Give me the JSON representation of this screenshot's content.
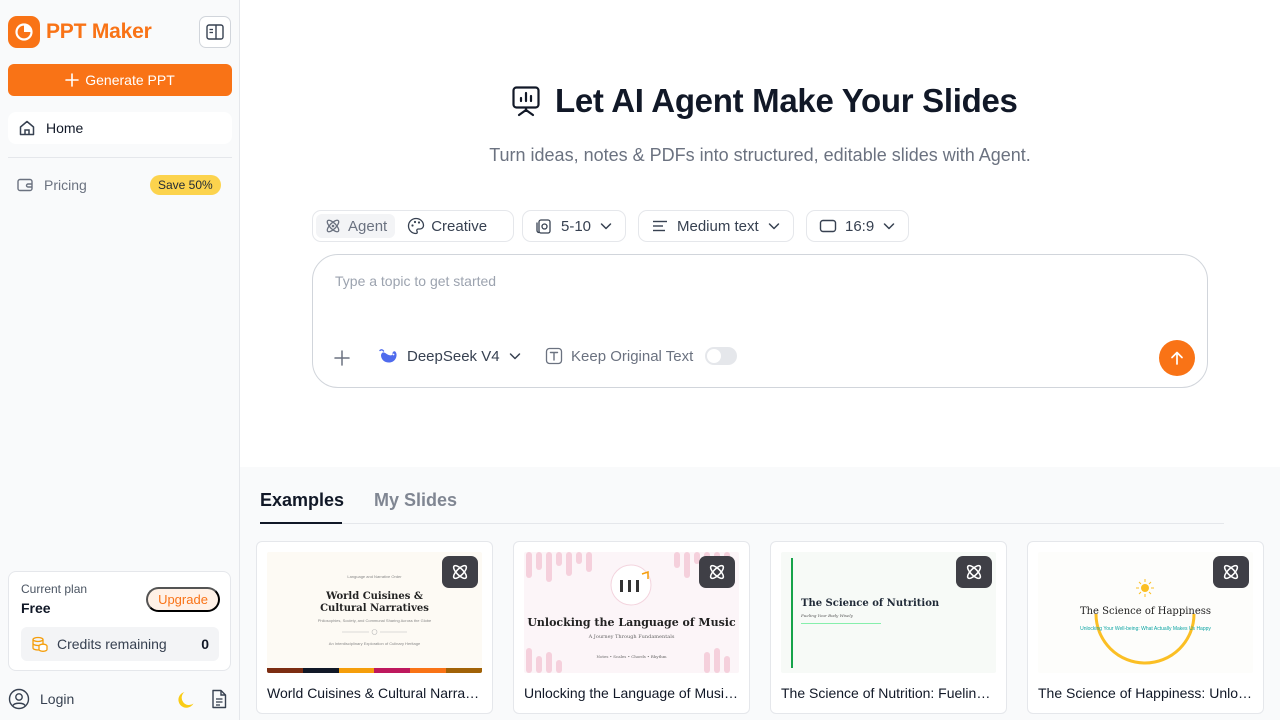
{
  "app": {
    "name": "PPT Maker",
    "accent": "#f97316"
  },
  "sidebar": {
    "generate_label": "Generate PPT",
    "nav": [
      {
        "label": "Home",
        "icon": "home-icon"
      },
      {
        "label": "Pricing",
        "icon": "wallet-icon",
        "badge": "Save 50%"
      }
    ],
    "plan": {
      "label": "Current plan",
      "value": "Free",
      "upgrade_label": "Upgrade"
    },
    "credits": {
      "label": "Credits remaining",
      "count": "0"
    },
    "login_label": "Login"
  },
  "hero": {
    "title": "Let AI Agent Make Your Slides",
    "subtitle": "Turn ideas, notes & PDFs into structured, editable slides with Agent."
  },
  "options": {
    "modes": [
      {
        "label": "Agent",
        "active": true
      },
      {
        "label": "Creative",
        "active": false
      }
    ],
    "slide_count": "5-10",
    "text_amount": "Medium text",
    "aspect_ratio": "16:9"
  },
  "prompt": {
    "placeholder": "Type a topic to get started",
    "model": "DeepSeek V4",
    "keep_original_label": "Keep Original Text",
    "keep_original_on": false
  },
  "tabs": [
    {
      "label": "Examples",
      "active": true
    },
    {
      "label": "My Slides",
      "active": false
    }
  ],
  "examples": [
    {
      "caption": "World Cuisines & Cultural Narratives: Philosophy, Society, and Communal Sharing Across the Globe",
      "thumb_title_1": "World Cuisines &",
      "thumb_title_2": "Cultural Narratives",
      "thumb_top": "Language and Narrative Order",
      "thumb_sub": "Philosophies, Society, and Communal Sharing Across the Globe",
      "thumb_footer": "An Interdisciplinary Exploration of Culinary Heritage"
    },
    {
      "caption": "Unlocking the Language of Music: A Journey Through Fundamentals",
      "thumb_title": "Unlocking the Language of Music",
      "thumb_sub": "A Journey Through Fundamentals",
      "thumb_footer": "Notes • Scales • Chords • Rhythm"
    },
    {
      "caption": "The Science of Nutrition: Fueling Your Body Wisely",
      "thumb_title": "The Science of Nutrition",
      "thumb_sub": "Fueling Your Body Wisely"
    },
    {
      "caption": "The Science of Happiness: Unlocking Your Well-being: What Actually Makes Us Happy",
      "thumb_title": "The Science of Happiness",
      "thumb_sub": "Unlocking Your Well-being: What Actually Makes Us Happy"
    }
  ]
}
